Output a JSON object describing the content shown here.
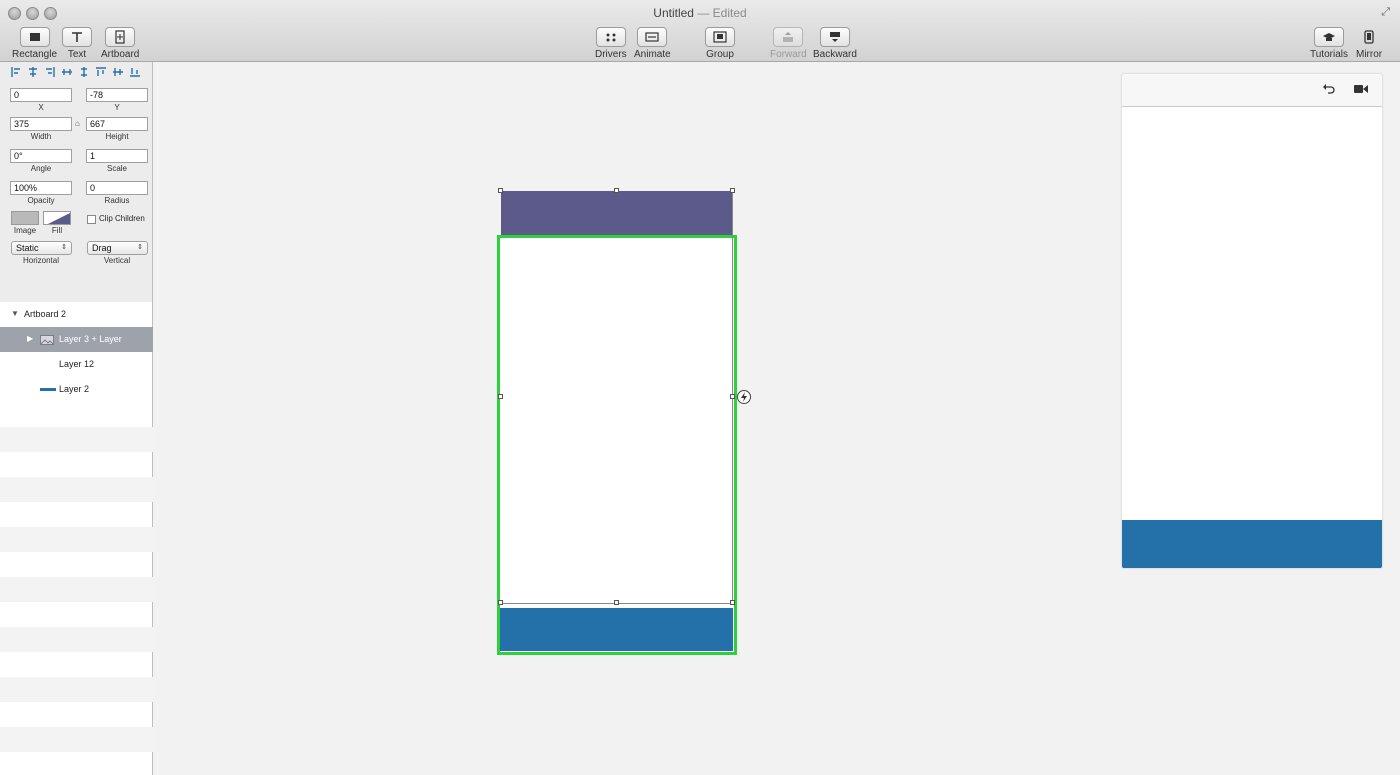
{
  "window": {
    "title": "Untitled",
    "title_separator": "—",
    "title_status": "Edited"
  },
  "toolbar": {
    "left": [
      {
        "label": "Rectangle",
        "icon": "rectangle-icon"
      },
      {
        "label": "Text",
        "icon": "text-icon"
      },
      {
        "label": "Artboard",
        "icon": "artboard-icon"
      }
    ],
    "center": [
      {
        "label": "Drivers",
        "icon": "drivers-icon"
      },
      {
        "label": "Animate",
        "icon": "animate-icon"
      },
      {
        "label": "Group",
        "icon": "group-icon"
      },
      {
        "label": "Forward",
        "icon": "forward-icon",
        "disabled": true
      },
      {
        "label": "Backward",
        "icon": "backward-icon"
      }
    ],
    "right": [
      {
        "label": "Tutorials",
        "icon": "graduation-cap-icon"
      },
      {
        "label": "Mirror",
        "icon": "phone-icon"
      }
    ]
  },
  "inspector": {
    "x": {
      "value": "0",
      "label": "X"
    },
    "y": {
      "value": "-78",
      "label": "Y"
    },
    "width": {
      "value": "375",
      "label": "Width"
    },
    "height": {
      "value": "667",
      "label": "Height"
    },
    "angle": {
      "value": "0°",
      "label": "Angle"
    },
    "scale": {
      "value": "1",
      "label": "Scale"
    },
    "opacity": {
      "value": "100%",
      "label": "Opacity"
    },
    "radius": {
      "value": "0",
      "label": "Radius"
    },
    "image_label": "Image",
    "fill_label": "Fill",
    "clip_children_label": "Clip Children",
    "clip_children_checked": false,
    "horizontal": {
      "value": "Static",
      "label": "Horizontal"
    },
    "vertical": {
      "value": "Drag",
      "label": "Vertical"
    }
  },
  "layers": {
    "artboard": "Artboard 2",
    "items": [
      {
        "label": "Layer 3 + Layer",
        "selected": true,
        "icon": "image-layer-icon"
      },
      {
        "label": "Layer 12",
        "selected": false
      },
      {
        "label": "Layer 2",
        "selected": false,
        "icon": "line-layer-icon"
      }
    ]
  },
  "colors": {
    "header_purple": "#5b5a8a",
    "footer_blue": "#2471a9",
    "selection_green": "#2fd13a",
    "layer_selected": "#9ea3ab"
  },
  "preview": {
    "refresh_icon": "undo-icon",
    "record_icon": "video-camera-icon"
  }
}
